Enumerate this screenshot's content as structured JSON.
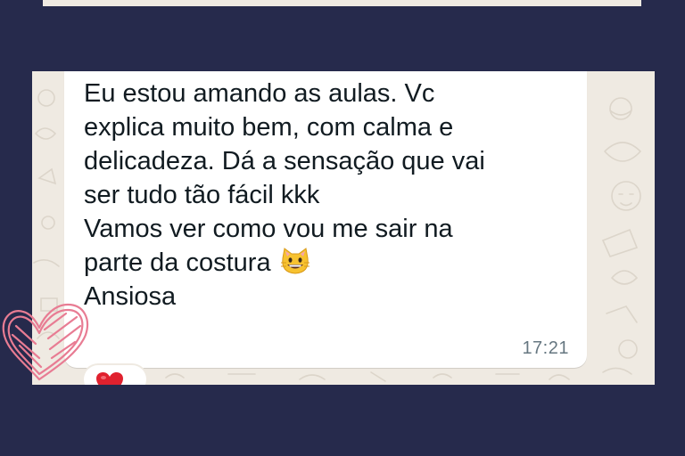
{
  "message": {
    "lines_before_emoji": "Eu estou amando as aulas. Vc\nexplica muito bem, com calma e\ndelicadeza. Dá a sensação que vai\nser tudo tão fácil kkk\nVamos ver como vou me sair na\nparte da costura",
    "lines_after_emoji": "\nAnsiosa",
    "emoji_icon": "grinning-cat-face-emoji",
    "time": "17:21"
  },
  "reaction": {
    "icon": "red-heart-emoji"
  },
  "decoration": {
    "icon": "pink-scribble-heart",
    "color": "#e87c93"
  },
  "colors": {
    "background": "#262a4c",
    "chat_wallpaper": "#efeae2",
    "bubble": "#ffffff",
    "text": "#111b21",
    "timestamp": "#667781"
  }
}
